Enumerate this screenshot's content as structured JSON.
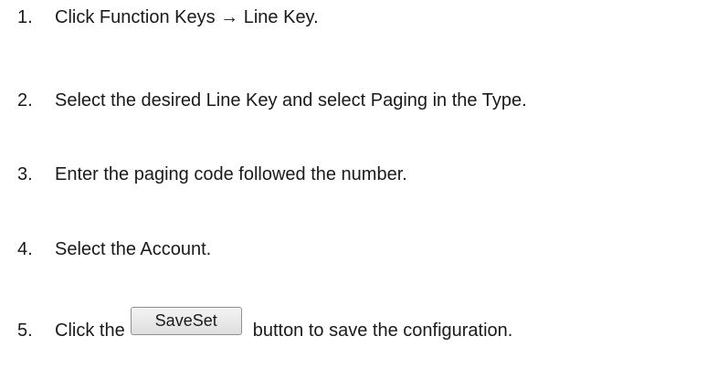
{
  "steps": [
    {
      "number": "1.",
      "text": "Click Function Keys → Line Key."
    },
    {
      "number": "2.",
      "text": "Select the desired Line Key and select Paging in the Type."
    },
    {
      "number": "3.",
      "text": "Enter the paging code followed the number."
    },
    {
      "number": "4.",
      "text": "Select the Account."
    },
    {
      "number": "5.",
      "text_before": "Click the",
      "button_label": "SaveSet",
      "text_after": "button to save the configuration."
    }
  ]
}
